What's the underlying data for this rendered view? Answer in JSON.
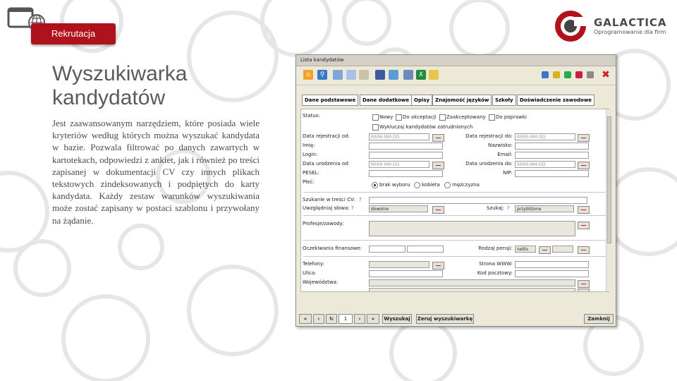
{
  "badge": "Rekrutacja",
  "logo": {
    "name": "GALACTICA",
    "tagline": "Oprogramowanie dla firm"
  },
  "page_title": "Wyszukiwarka kandydatów",
  "description": "Jest zaawansowanym narzędziem, które posiada wiele kryteriów według których można wyszukać kandydata w bazie. Pozwala filtrować po danych zawartych w kartotekach, odpowiedzi z ankiet, jak i również po treści zapisanej w dokumentacji CV czy innych plikach tekstowych zindeksowanych i podpiętych do karty kandydata. Każdy zestaw warunków wyszukiwania może zostać zapisany w postaci szablonu i przywołany na żądanie.",
  "window": {
    "title": "Lista kandydatów",
    "tabs": [
      "Dane podstawowe",
      "Dane dodatkowe",
      "Opisy",
      "Znajomość języków",
      "Szkoły",
      "Doświadczenie zawodowe"
    ],
    "toolbar_colors": [
      "#3a77c9",
      "#d8b21e",
      "#2aa84a",
      "#c8204a",
      "#8a8a8a"
    ],
    "form": {
      "status_label": "Status:",
      "status_options": [
        "Nowy",
        "Do akceptacji",
        "Zaakceptowany",
        "Do poprawki"
      ],
      "exclude_hired": "Wykluczaj kandydatów zatrudnionych",
      "reg_from": "Data rejestracji od:",
      "reg_to": "Data rejestracji do:",
      "date_placeholder": "RRRR-MM-DD",
      "first_name": "Imię:",
      "last_name": "Nazwisko:",
      "login": "Login:",
      "email": "Email:",
      "birth_from": "Data urodzenia od:",
      "birth_to": "Data urodzenia do:",
      "pesel": "PESEL:",
      "nip": "NIP:",
      "gender_label": "Płeć:",
      "gender_options": [
        "brak wyboru",
        "kobieta",
        "mężczyzna"
      ],
      "cv_search": "Szukanie w treści CV:",
      "include_words": "Uwzględniaj słowa:",
      "include_words_value": "dowolne",
      "search_mode": "Szukaj:",
      "search_mode_value": "przybliżone",
      "profession": "Profesje/zawody:",
      "salary": "Oczekiwania finansowe:",
      "salary_type": "Rodzaj pensji:",
      "salary_type_value": "netto",
      "phones": "Telefony:",
      "www": "Strona WWW:",
      "street": "Ulica:",
      "postal": "Kod pocztowy:",
      "voivodeship": "Województwa:",
      "help_mark": "?"
    },
    "bottom": {
      "page_number": "1",
      "search_button": "Wyszukaj",
      "reset_button": "Zeruj wyszukiwarkę",
      "close_button": "Zamknij",
      "first": "«",
      "prev": "‹",
      "refresh": "↻",
      "next": "›",
      "last": "»"
    }
  }
}
